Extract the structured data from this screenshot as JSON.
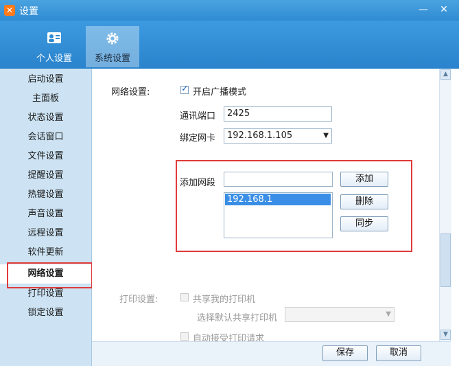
{
  "window": {
    "title": "设置",
    "logo_glyph": "✕",
    "minimize_glyph": "—",
    "close_glyph": "✕"
  },
  "tabs": [
    {
      "label": "个人设置",
      "icon": "person-card-icon",
      "active": false
    },
    {
      "label": "系统设置",
      "icon": "gear-icon",
      "active": true
    }
  ],
  "sidebar": {
    "items": [
      {
        "label": "启动设置"
      },
      {
        "label": "主面板"
      },
      {
        "label": "状态设置"
      },
      {
        "label": "会话窗口"
      },
      {
        "label": "文件设置"
      },
      {
        "label": "提醒设置"
      },
      {
        "label": "热键设置"
      },
      {
        "label": "声音设置"
      },
      {
        "label": "远程设置"
      },
      {
        "label": "软件更新"
      },
      {
        "label": "网络设置",
        "active": true
      },
      {
        "label": "打印设置"
      },
      {
        "label": "锁定设置"
      }
    ]
  },
  "network": {
    "section_label": "网络设置:",
    "broadcast_label": "开启广播模式",
    "broadcast_checked": true,
    "port_label": "通讯端口",
    "port_value": "2425",
    "nic_label": "绑定网卡",
    "nic_value": "192.168.1.105",
    "add_segment_label": "添加网段",
    "add_segment_value": "",
    "segments": [
      "192.168.1"
    ],
    "add_button": "添加",
    "delete_button": "删除",
    "sync_button": "同步"
  },
  "print": {
    "section_label": "打印设置:",
    "share_printer_label": "共享我的打印机",
    "default_printer_label": "选择默认共享打印机",
    "auto_accept_label": "自动接受打印请求"
  },
  "footer": {
    "save_button": "保存",
    "cancel_button": "取消"
  },
  "colors": {
    "header_blue": "#2f8bd2",
    "sidebar_bg": "#cde3f3",
    "highlight_red": "#e03a3a",
    "selection_blue": "#3a8ee6"
  }
}
